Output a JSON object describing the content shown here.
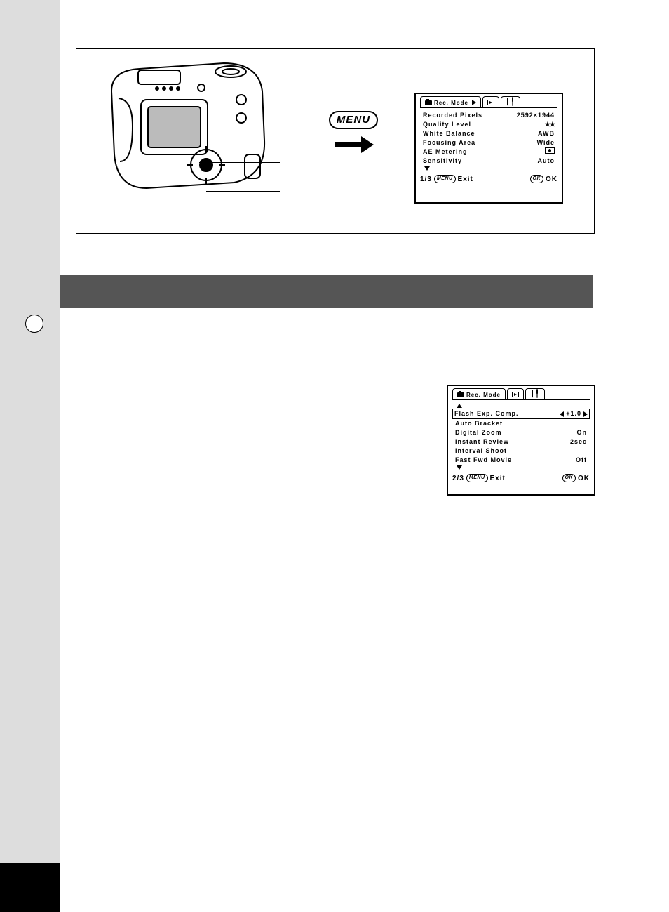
{
  "menu_button_label": "MENU",
  "screen1": {
    "tab_label": "Rec. Mode",
    "rows": [
      {
        "label": "Recorded Pixels",
        "value": "2592×1944"
      },
      {
        "label": "Quality Level",
        "value": "★★"
      },
      {
        "label": "White Balance",
        "value": "AWB"
      },
      {
        "label": "Focusing Area",
        "value": "Wide"
      },
      {
        "label": "AE Metering",
        "value": "meter-icon"
      },
      {
        "label": "Sensitivity",
        "value": "Auto"
      }
    ],
    "page": "1/3",
    "exit_pill": "MENU",
    "exit_label": "Exit",
    "ok_pill": "OK",
    "ok_label": "OK"
  },
  "screen2": {
    "tab_label": "Rec. Mode",
    "rows": [
      {
        "label": "Flash Exp. Comp.",
        "value": "+1.0",
        "selected": true
      },
      {
        "label": "Auto Bracket",
        "value": ""
      },
      {
        "label": "Digital Zoom",
        "value": "On"
      },
      {
        "label": "Instant Review",
        "value": "2sec"
      },
      {
        "label": "Interval Shoot",
        "value": ""
      },
      {
        "label": "Fast Fwd Movie",
        "value": "Off"
      }
    ],
    "page": "2/3",
    "exit_pill": "MENU",
    "exit_label": "Exit",
    "ok_pill": "OK",
    "ok_label": "OK"
  }
}
